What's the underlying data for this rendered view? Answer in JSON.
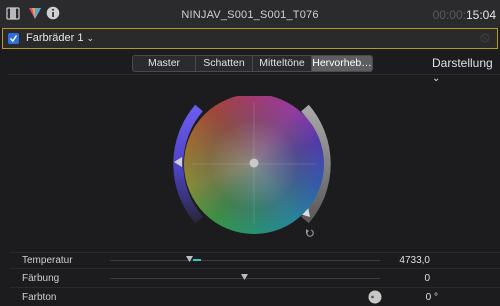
{
  "header": {
    "clip_name": "NINJAV_S001_S001_T076",
    "timecode_dim": "00:00:",
    "timecode_main": "15:04"
  },
  "correction": {
    "label": "Farbräder 1",
    "checked": true
  },
  "tabs": [
    {
      "label": "Master",
      "active": false
    },
    {
      "label": "Schatten",
      "active": false
    },
    {
      "label": "Mitteltöne",
      "active": false
    },
    {
      "label": "Hervorheb…",
      "active": true
    }
  ],
  "view_menu": {
    "label": "Darstellung"
  },
  "colors": {
    "accent_yellow": "#b59a2a",
    "checkbox_blue": "#2f6fdc",
    "highlight_arc_left": "#5b50d8",
    "highlight_arc_right": "#cfcfcf",
    "temperature_tint": "#2ec6c6"
  },
  "sliders": [
    {
      "id": "temperature",
      "label": "Temperatur",
      "value": "4733,0"
    },
    {
      "id": "tint",
      "label": "Färbung",
      "value": "0"
    },
    {
      "id": "hue",
      "label": "Farbton",
      "value": "0 °"
    }
  ]
}
